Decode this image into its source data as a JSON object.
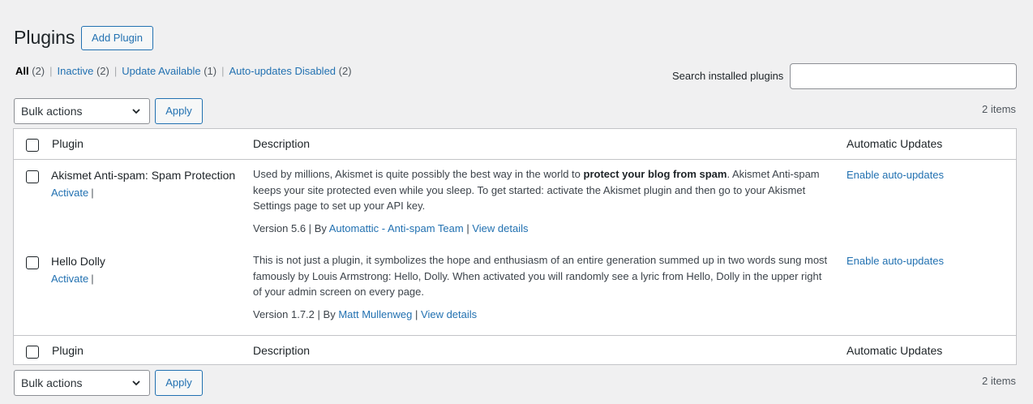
{
  "header": {
    "title": "Plugins",
    "add_label": "Add Plugin"
  },
  "filters": [
    {
      "label": "All",
      "count": "(2)",
      "current": true
    },
    {
      "label": "Inactive",
      "count": "(2)"
    },
    {
      "label": "Update Available",
      "count": "(1)"
    },
    {
      "label": "Auto-updates Disabled",
      "count": "(2)"
    }
  ],
  "search": {
    "label": "Search installed plugins",
    "value": ""
  },
  "bulk": {
    "selected": "Bulk actions",
    "apply_label": "Apply",
    "items_count": "2 items"
  },
  "columns": {
    "plugin": "Plugin",
    "description": "Description",
    "auto_updates": "Automatic Updates"
  },
  "plugins": [
    {
      "name": "Akismet Anti-spam: Spam Protection",
      "action": "Activate",
      "desc_before": "Used by millions, Akismet is quite possibly the best way in the world to ",
      "desc_bold": "protect your blog from spam",
      "desc_after": ". Akismet Anti-spam keeps your site protected even while you sleep. To get started: activate the Akismet plugin and then go to your Akismet Settings page to set up your API key.",
      "version": "Version 5.6",
      "by": "By",
      "author": "Automattic - Anti-spam Team",
      "details": "View details",
      "auto_update": "Enable auto-updates"
    },
    {
      "name": "Hello Dolly",
      "action": "Activate",
      "desc_before": "This is not just a plugin, it symbolizes the hope and enthusiasm of an entire generation summed up in two words sung most famously by Louis Armstrong: Hello, Dolly. When activated you will randomly see a lyric from Hello, Dolly in the upper right of your admin screen on every page.",
      "desc_bold": "",
      "desc_after": "",
      "version": "Version 1.7.2",
      "by": "By",
      "author": "Matt Mullenweg",
      "details": "View details",
      "auto_update": "Enable auto-updates"
    }
  ]
}
